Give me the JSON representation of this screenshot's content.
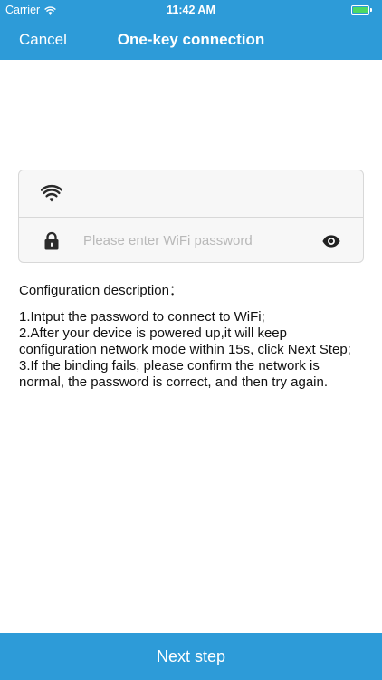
{
  "status_bar": {
    "carrier": "Carrier",
    "time": "11:42 AM",
    "battery_level": 1.0,
    "battery_color": "#4cd964"
  },
  "nav": {
    "cancel_label": "Cancel",
    "title": "One-key connection"
  },
  "form": {
    "wifi_icon": "wifi-icon",
    "ssid_value": "",
    "lock_icon": "lock-icon",
    "password_value": "",
    "password_placeholder": "Please enter WiFi password",
    "visibility_icon": "eye-icon"
  },
  "description": {
    "title": "Configuration description：",
    "steps": [
      "1.Intput the password to connect to WiFi;",
      "2.After your device is powered up,it will keep configuration network mode within 15s, click Next Step;",
      "3.If the binding fails, please confirm the network is normal, the password is correct, and then try again."
    ]
  },
  "footer": {
    "next_label": "Next step"
  },
  "colors": {
    "accent": "#2d9bd8",
    "card_background": "#f7f7f7",
    "card_border": "#d8d8d8",
    "placeholder": "#b9b9b9"
  }
}
